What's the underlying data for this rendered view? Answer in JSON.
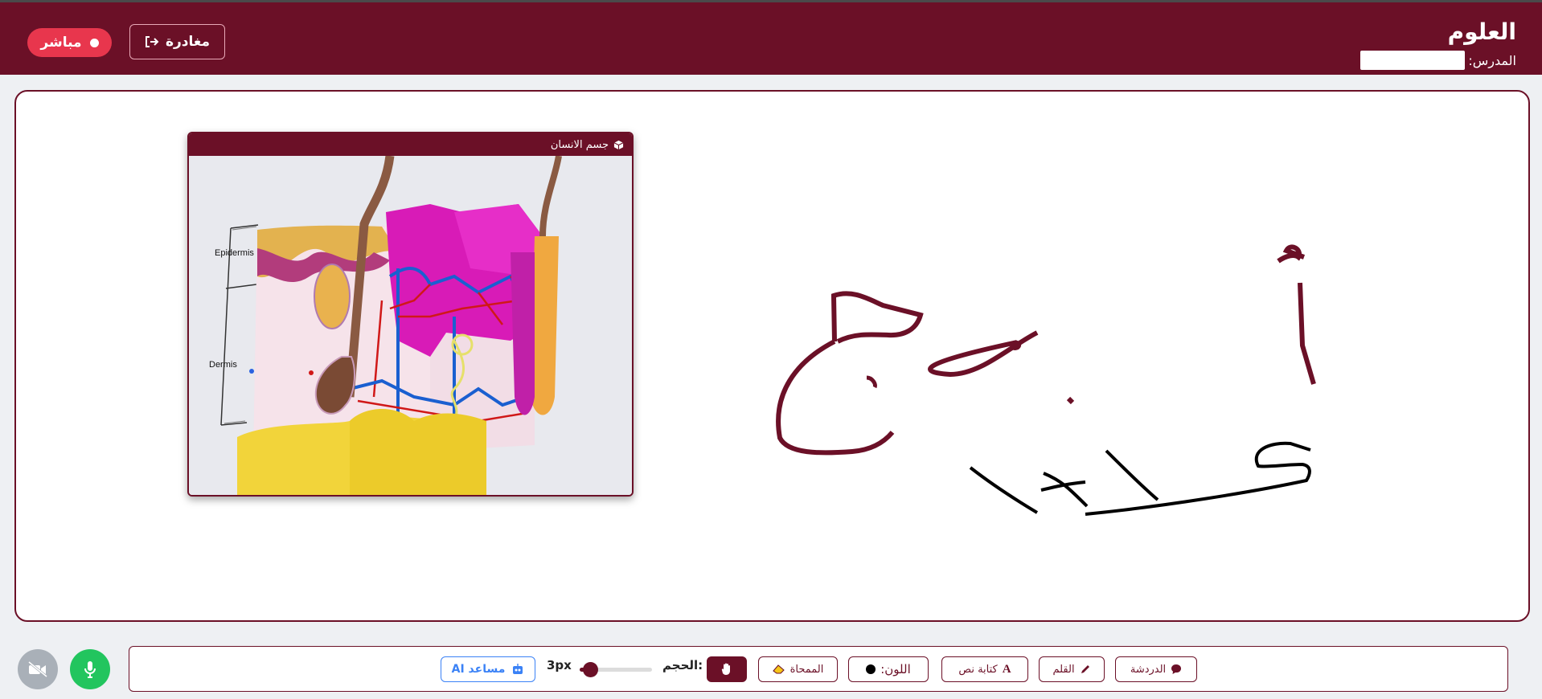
{
  "header": {
    "title": "العلوم",
    "teacher_label": "المدرس:",
    "leave_label": "مغادرة",
    "live_label": "مباشر"
  },
  "model_window": {
    "title": "جسم الانسان",
    "labels": [
      "Epidermis",
      "Dermis"
    ]
  },
  "toolbar": {
    "chat_label": "الدردشة",
    "pen_label": "القلم",
    "text_label": "كتابة نص",
    "color_label": "اللون:",
    "eraser_label": "الممحاة",
    "size_label": "الحجم:",
    "size_value": "3px",
    "size_level": 3,
    "ai_label": "مساعد AI"
  },
  "colors": {
    "brand": "#6b1027",
    "live": "#e8364d",
    "mic": "#22c55e",
    "camera_off": "#a9b0b8",
    "ai": "#3b82f6",
    "ink_dark": "#6b1027",
    "ink_black": "#000000"
  },
  "icons": {
    "leave": "sign-out-icon",
    "chat": "comment-icon",
    "pen": "pen-icon",
    "text": "font-icon",
    "eraser": "eraser-icon",
    "hand": "hand-icon",
    "ai": "robot-icon",
    "mic": "microphone-icon",
    "camera": "video-slash-icon",
    "model": "cube-icon"
  }
}
